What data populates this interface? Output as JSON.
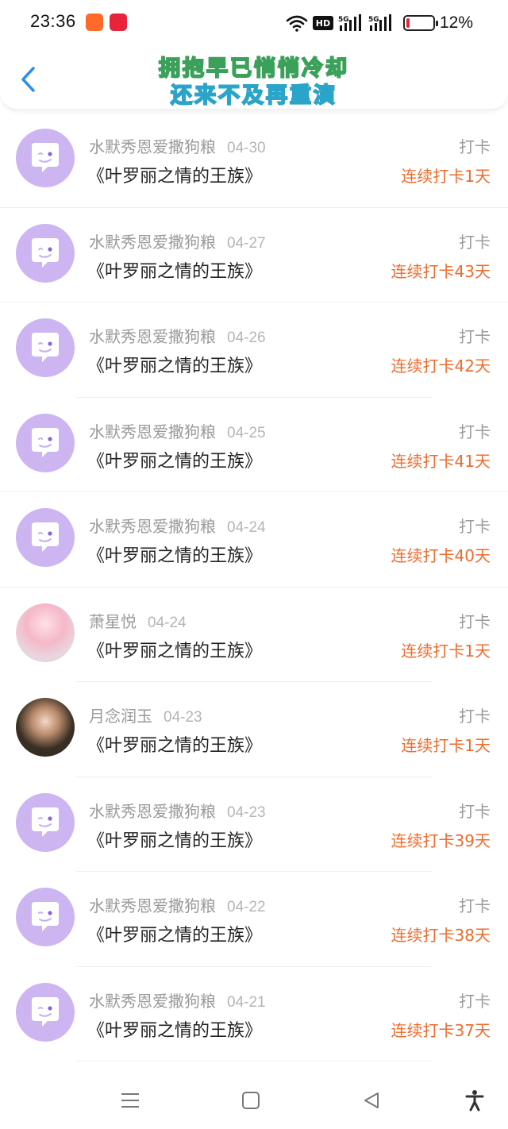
{
  "status_bar": {
    "time": "23:36",
    "hd_label": "HD",
    "network_label": "5G",
    "battery_percent_text": "12%",
    "battery_level": 0.12,
    "battery_color": "#e8243c"
  },
  "header": {
    "title_line1": "拥抱早已悄悄冷却",
    "title_line2": "还来不及再重演",
    "back_icon": "chevron-left-icon",
    "accent_color": "#2f8fe8"
  },
  "items": [
    {
      "user": "水默秀恩爱撒狗粮",
      "date": "04-30",
      "book": "《叶罗丽之情的王族》",
      "action": "打卡",
      "streak": "连续打卡1天",
      "avatar": "default-chat-avatar"
    },
    {
      "user": "水默秀恩爱撒狗粮",
      "date": "04-27",
      "book": "《叶罗丽之情的王族》",
      "action": "打卡",
      "streak": "连续打卡43天",
      "avatar": "default-chat-avatar"
    },
    {
      "user": "水默秀恩爱撒狗粮",
      "date": "04-26",
      "book": "《叶罗丽之情的王族》",
      "action": "打卡",
      "streak": "连续打卡42天",
      "avatar": "default-chat-avatar"
    },
    {
      "user": "水默秀恩爱撒狗粮",
      "date": "04-25",
      "book": "《叶罗丽之情的王族》",
      "action": "打卡",
      "streak": "连续打卡41天",
      "avatar": "default-chat-avatar"
    },
    {
      "user": "水默秀恩爱撒狗粮",
      "date": "04-24",
      "book": "《叶罗丽之情的王族》",
      "action": "打卡",
      "streak": "连续打卡40天",
      "avatar": "default-chat-avatar"
    },
    {
      "user": "萧星悦",
      "date": "04-24",
      "book": "《叶罗丽之情的王族》",
      "action": "打卡",
      "streak": "连续打卡1天",
      "avatar": "photo-avatar"
    },
    {
      "user": "月念润玉",
      "date": "04-23",
      "book": "《叶罗丽之情的王族》",
      "action": "打卡",
      "streak": "连续打卡1天",
      "avatar": "photo-avatar"
    },
    {
      "user": "水默秀恩爱撒狗粮",
      "date": "04-23",
      "book": "《叶罗丽之情的王族》",
      "action": "打卡",
      "streak": "连续打卡39天",
      "avatar": "default-chat-avatar"
    },
    {
      "user": "水默秀恩爱撒狗粮",
      "date": "04-22",
      "book": "《叶罗丽之情的王族》",
      "action": "打卡",
      "streak": "连续打卡38天",
      "avatar": "default-chat-avatar"
    },
    {
      "user": "水默秀恩爱撒狗粮",
      "date": "04-21",
      "book": "《叶罗丽之情的王族》",
      "action": "打卡",
      "streak": "连续打卡37天",
      "avatar": "default-chat-avatar"
    }
  ],
  "colors": {
    "streak": "#f06b2c",
    "avatar_bg": "#cdb5f2"
  },
  "nav_bar": {
    "buttons": [
      "menu-icon",
      "home-square-icon",
      "back-triangle-icon",
      "accessibility-icon"
    ]
  }
}
